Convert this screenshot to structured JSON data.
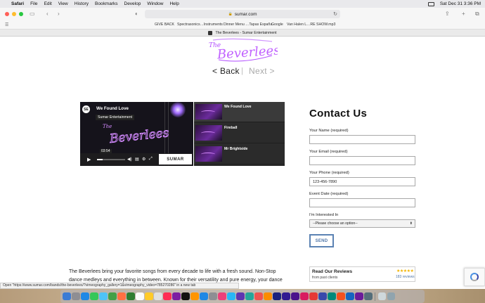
{
  "menubar": {
    "items": [
      "Safari",
      "File",
      "Edit",
      "View",
      "History",
      "Bookmarks",
      "Develop",
      "Window",
      "Help"
    ],
    "clock": "Sat Dec 31  3:36 PM"
  },
  "browser": {
    "url": "sumar.com",
    "favorites": [
      "GIVE BACK",
      "Spectrasonics…Instruments",
      "Dinner Menu …Tapas España",
      "Google",
      "Van Halen L…RE SHOW.mp3"
    ],
    "tab_title": "The Beverlees - Sumar Entertainment"
  },
  "page": {
    "logo_text": "The Beverlees",
    "nav_back": "< Back",
    "nav_sep": "|",
    "nav_next": "Next >",
    "video": {
      "channel_initials": "SE",
      "title": "We Found Love",
      "channel_chip": "Sumar Entertainment",
      "timestamp": "03:54",
      "watermark": "SUMAR"
    },
    "playlist": [
      {
        "title": "We Found Love"
      },
      {
        "title": "Fireball"
      },
      {
        "title": "Mr Brightside"
      }
    ],
    "contact": {
      "heading": "Contact Us",
      "name_label": "Your Name (required)",
      "name_value": "",
      "email_label": "Your Email (required)",
      "email_value": "",
      "phone_label": "Your Phone (required)",
      "phone_value": "123-456-7890",
      "date_label": "Event Date (required)",
      "date_value": "",
      "interest_label": "I'm Interested In",
      "interest_value": "--Please choose an option--",
      "send_label": "SEND"
    },
    "description": "The Beverlees bring your favorite songs from every decade to life with a fresh sound. Non-Stop dance medleys and everything in between. Known for their versatility and pure energy, your dance floor will",
    "reviews": {
      "title": "Read Our Reviews",
      "subtitle": "from past clients",
      "stars": "★★★★★",
      "count": "183 reviews"
    },
    "status_link": "Open \"https://www.sumar.com/bands/the-beverlees/?vimeography_gallery=1&vimeography_video=785270286\" in a new tab"
  },
  "colors": {
    "accent_link": "#4f76a8",
    "neon_purple": "#b14bff",
    "star_gold": "#f2b400"
  }
}
